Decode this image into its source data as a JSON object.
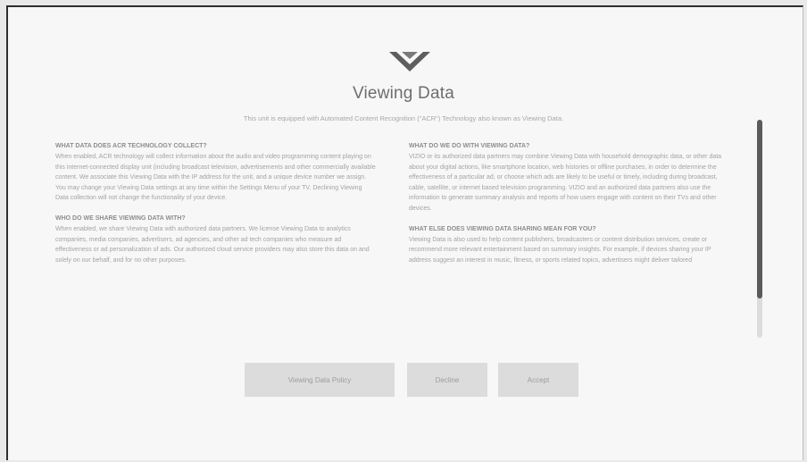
{
  "dialog": {
    "logo_icon": "vizio-v-logo-icon",
    "title": "Viewing Data",
    "subtitle": "This unit is equipped with Automated Content Recognition (\"ACR\") Technology also known as Viewing Data."
  },
  "sections_left": [
    {
      "heading": "WHAT DATA DOES ACR TECHNOLOGY COLLECT?",
      "body": "When enabled, ACR technology will collect information about the audio and video programming content playing on this internet-connected display unit (including broadcast television, advertisements and other commercially available content. We associate this Viewing Data with the IP address for the unit, and a unique device number we assign. You may change your Viewing Data settings at any time within the Settings Menu of your TV. Declining Viewing Data collection will not change the functionality of your device."
    },
    {
      "heading": "WHO DO WE SHARE VIEWING DATA WITH?",
      "body": "When enabled, we share Viewing Data with authorized data partners. We license Viewing Data to analytics companies, media companies, advertisers, ad agencies, and other ad tech companies who measure ad effectiveness or ad personalization of ads. Our authorized cloud service providers may also store this data on and solely on our behalf, and for no other purposes."
    }
  ],
  "sections_right": [
    {
      "heading": "WHAT DO WE DO WITH VIEWING DATA?",
      "body": "VIZIO or its authorized data partners may combine Viewing Data with household demographic data, or other data about your digital actions, like smartphone location, web histories or offline purchases, in order to determine the effectiveness of a particular ad, or choose which ads are likely to be useful or timely, including during broadcast, cable, satellite, or internet based television programming. VIZIO and an authorized data partners also use the information to generate summary analysis and reports of how users engage with content on their TVs and other devices."
    },
    {
      "heading": "WHAT ELSE DOES VIEWING DATA SHARING MEAN FOR YOU?",
      "body": "Viewing Data is also used to help content publishers, broadcasters or content distribution services, create or recommend more relevant entertainment based on summary insights. For example, if devices sharing your IP address suggest an interest in music, fitness, or sports related topics, advertisers might deliver tailored"
    }
  ],
  "buttons": {
    "policy": "Viewing Data Policy",
    "decline": "Decline",
    "accept": "Accept"
  }
}
